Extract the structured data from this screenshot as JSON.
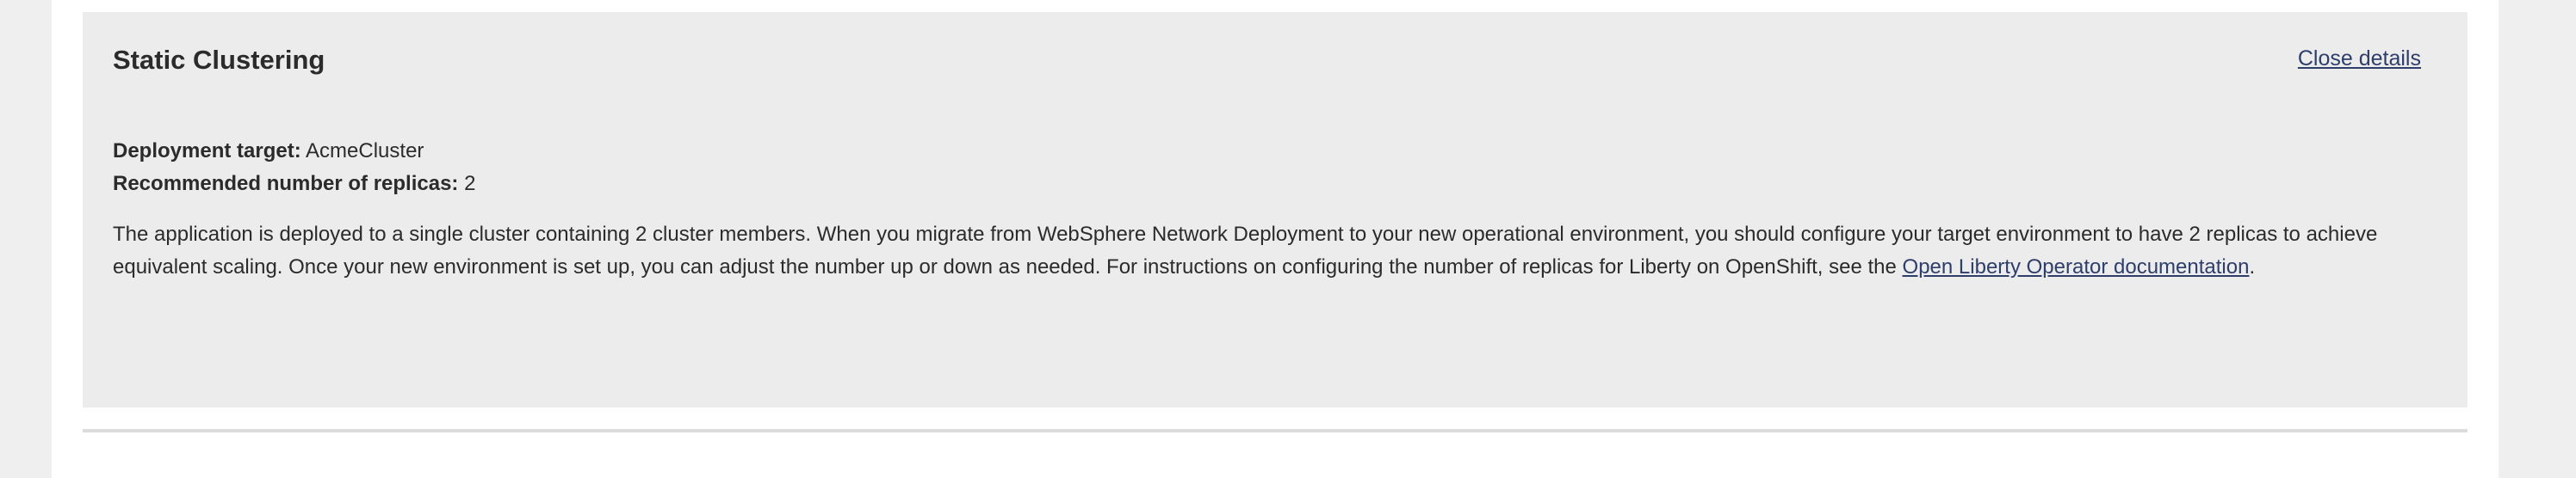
{
  "panel": {
    "title": "Static Clustering",
    "close_label": "Close details",
    "deployment_target_label": "Deployment target:",
    "deployment_target_value": "AcmeCluster",
    "replicas_label": "Recommended number of replicas:",
    "replicas_value": "2",
    "description_text": "The application is deployed to a single cluster containing 2 cluster members. When you migrate from WebSphere Network Deployment to your new operational environment, you should configure your target environment to have 2 replicas to achieve equivalent scaling. Once your new environment is set up, you can adjust the number up or down as needed. For instructions on configuring the number of replicas for Liberty on OpenShift, see the",
    "doc_link_label": "Open Liberty Operator documentation",
    "description_end": "."
  },
  "colors": {
    "panel_background": "#ececec",
    "page_background": "#efefef",
    "link": "#2d3e6b",
    "text": "#2b2b2b"
  }
}
